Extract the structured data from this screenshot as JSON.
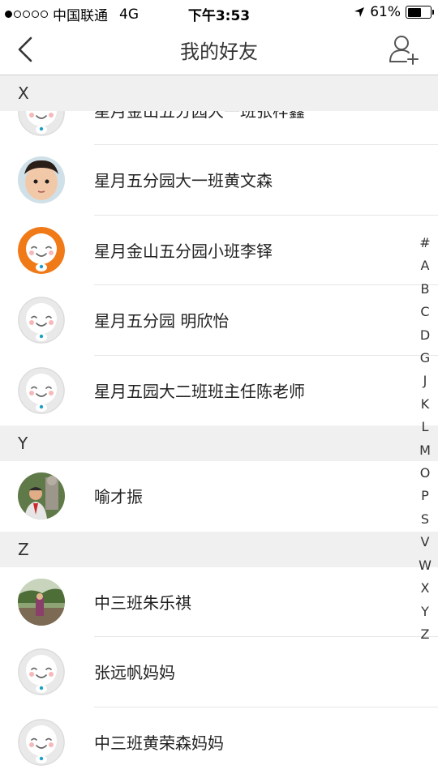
{
  "status": {
    "carrier": "中国联通",
    "network": "4G",
    "time": "下午3:53",
    "battery": "61%",
    "battery_level": 0.61
  },
  "nav": {
    "title": "我的好友",
    "back_icon": "chevron-left-icon",
    "add_icon": "add-friend-icon"
  },
  "sections": [
    {
      "letter": "X",
      "contacts": [
        {
          "name": "星月金山五分园大一班张梓鑫",
          "avatar": "cartoon-gray",
          "partial": true
        },
        {
          "name": "星月五分园大一班黄文森",
          "avatar": "photo-child"
        },
        {
          "name": "星月金山五分园小班李铎",
          "avatar": "cartoon-orange"
        },
        {
          "name": "星月五分园 明欣怡",
          "avatar": "cartoon-gray"
        },
        {
          "name": "星月五园大二班班主任陈老师",
          "avatar": "cartoon-gray"
        }
      ]
    },
    {
      "letter": "Y",
      "contacts": [
        {
          "name": "喻才振",
          "avatar": "photo-man"
        }
      ]
    },
    {
      "letter": "Z",
      "contacts": [
        {
          "name": "中三班朱乐祺",
          "avatar": "photo-outdoor"
        },
        {
          "name": "张远帆妈妈",
          "avatar": "cartoon-gray"
        },
        {
          "name": "中三班黄荣森妈妈",
          "avatar": "cartoon-gray"
        }
      ]
    }
  ],
  "index_letters": [
    "#",
    "A",
    "B",
    "C",
    "D",
    "G",
    "J",
    "K",
    "L",
    "M",
    "O",
    "P",
    "S",
    "V",
    "W",
    "X",
    "Y",
    "Z"
  ]
}
